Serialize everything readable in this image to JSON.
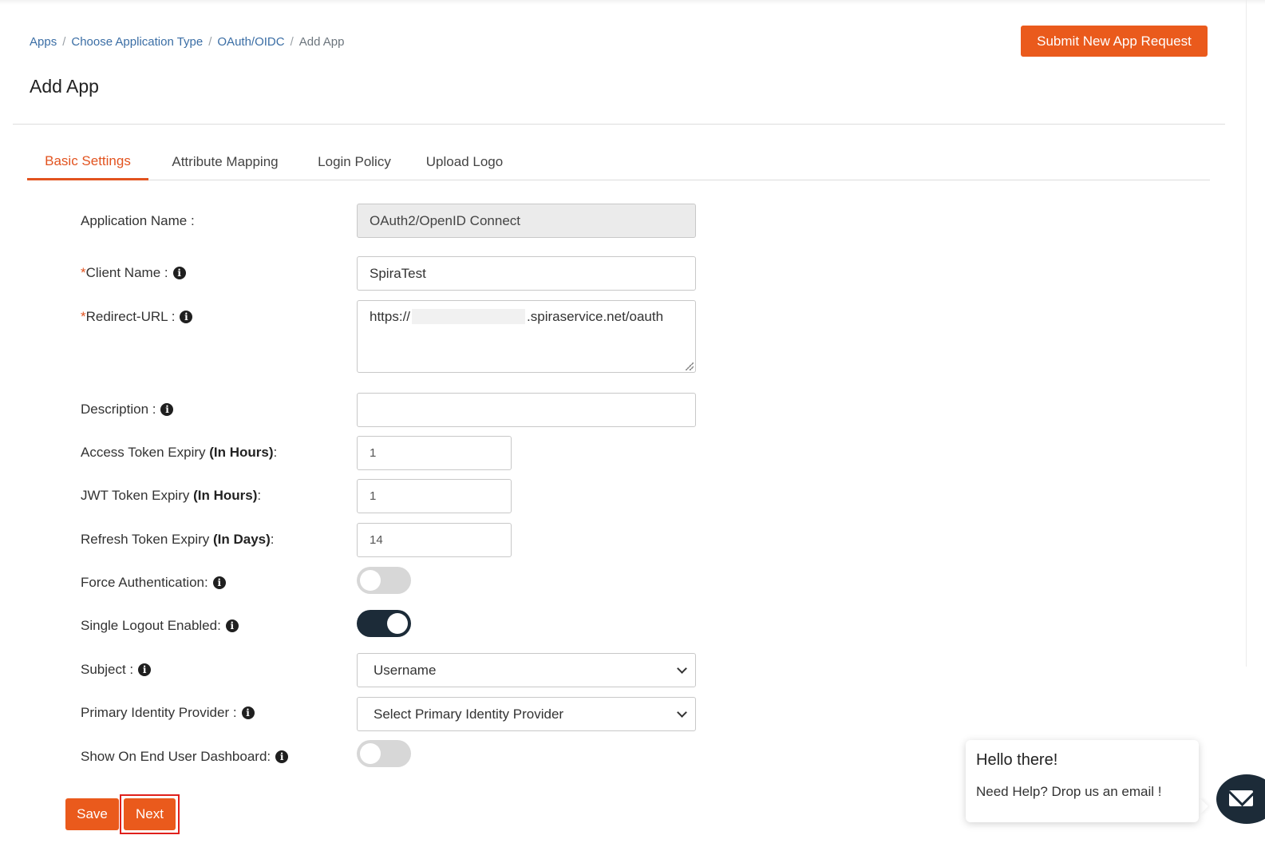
{
  "breadcrumb": {
    "items": [
      "Apps",
      "Choose Application Type",
      "OAuth/OIDC"
    ],
    "current": "Add App",
    "separator": "/"
  },
  "page_title": "Add App",
  "submit_button": "Submit New App Request",
  "tabs": [
    {
      "label": "Basic Settings",
      "active": true
    },
    {
      "label": "Attribute Mapping",
      "active": false
    },
    {
      "label": "Login Policy",
      "active": false
    },
    {
      "label": "Upload Logo",
      "active": false
    }
  ],
  "form": {
    "required_mark": "*",
    "application_name": {
      "label": "Application Name :",
      "value": "OAuth2/OpenID Connect"
    },
    "client_name": {
      "label": "Client Name :",
      "value": "SpiraTest"
    },
    "redirect_url": {
      "label": "Redirect-URL :",
      "value_prefix": "https://",
      "value_suffix": ".spiraservice.net/oauth"
    },
    "description": {
      "label": "Description :",
      "value": ""
    },
    "access_token_expiry": {
      "label": "Access Token Expiry ",
      "label_bold": "(In Hours)",
      "label_end": ":",
      "value": "1"
    },
    "jwt_token_expiry": {
      "label": "JWT Token Expiry ",
      "label_bold": "(In Hours)",
      "label_end": ":",
      "value": "1"
    },
    "refresh_token_expiry": {
      "label": "Refresh Token Expiry ",
      "label_bold": "(In Days)",
      "label_end": ":",
      "value": "14"
    },
    "force_authentication": {
      "label": "Force Authentication:",
      "enabled": false
    },
    "single_logout": {
      "label": "Single Logout Enabled:",
      "enabled": true
    },
    "subject": {
      "label": "Subject :",
      "selected": "Username"
    },
    "primary_idp": {
      "label": "Primary Identity Provider :",
      "selected": "Select Primary Identity Provider"
    },
    "show_on_dashboard": {
      "label": "Show On End User Dashboard:",
      "enabled": false
    }
  },
  "actions": {
    "save": "Save",
    "next": "Next"
  },
  "chat": {
    "greeting": "Hello there!",
    "message": "Need Help? Drop us an email !"
  },
  "icons": {
    "info": "info-icon",
    "mail": "mail-icon",
    "chevron": "chevron-down-icon"
  },
  "colors": {
    "accent": "#ea5a1c",
    "dark": "#1c2b38",
    "link": "#3b6ea5",
    "highlight": "#e0201c"
  }
}
